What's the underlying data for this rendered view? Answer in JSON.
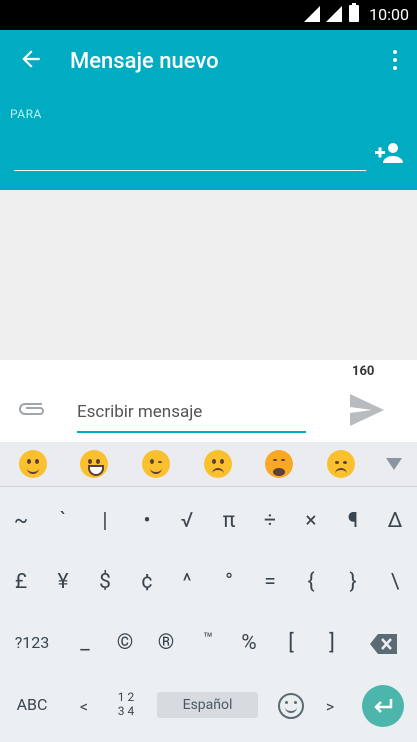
{
  "status": {
    "time": "10:00"
  },
  "header": {
    "title": "Mensaje nuevo",
    "to_label": "PARA"
  },
  "compose": {
    "char_count": "160",
    "placeholder": "Escribir mensaje"
  },
  "emoji_bar": {
    "emojis": [
      "smiling face",
      "grinning face with tears",
      "winking face",
      "frowning face",
      "tired face",
      "angry face"
    ]
  },
  "keyboard": {
    "row1": [
      "~",
      "`",
      "|",
      "•",
      "√",
      "π",
      "÷",
      "×",
      "¶",
      "Δ"
    ],
    "row2": [
      "£",
      "¥",
      "$",
      "¢",
      "^",
      "°",
      "=",
      "{",
      "}",
      "\\"
    ],
    "row3": [
      "?123",
      "_",
      "©",
      "®",
      "™",
      "%",
      "[",
      "]"
    ],
    "row4": {
      "abc": "ABC",
      "lt": "<",
      "nums_top": "1 2",
      "nums_bottom": "3 4",
      "space": "Español",
      "gt": ">"
    }
  }
}
